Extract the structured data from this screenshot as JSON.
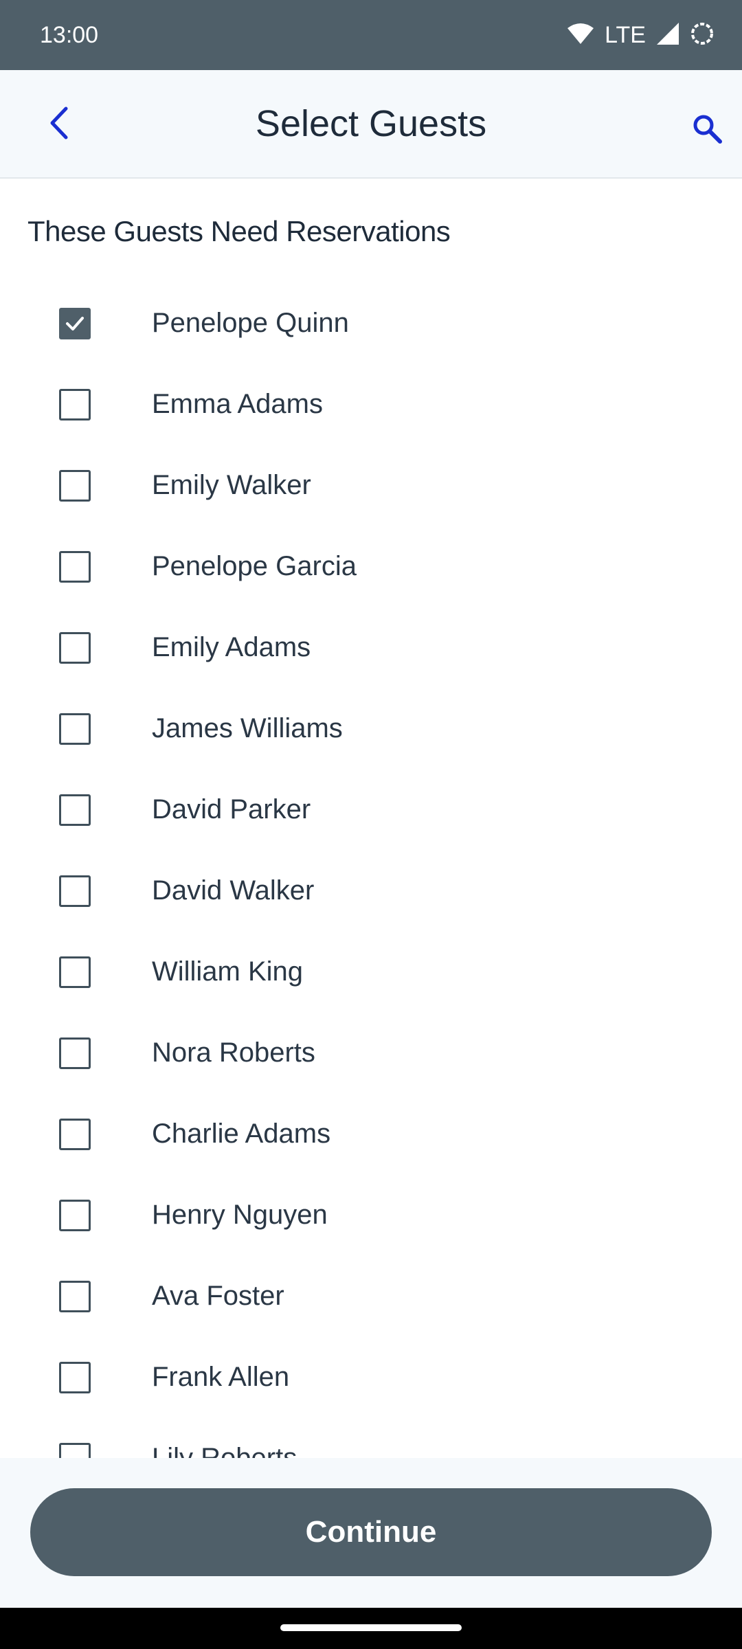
{
  "status_bar": {
    "time": "13:00",
    "network": "LTE",
    "icons": [
      "wifi-icon",
      "signal-icon",
      "battery-icon"
    ]
  },
  "app_bar": {
    "title": "Select Guests",
    "back_icon": "chevron-left-icon",
    "search_icon": "search-icon",
    "accent_color": "#1a2fd1"
  },
  "section": {
    "heading": "These Guests Need Reservations"
  },
  "guests": [
    {
      "name": "Penelope Quinn",
      "checked": true
    },
    {
      "name": "Emma Adams",
      "checked": false
    },
    {
      "name": "Emily Walker",
      "checked": false
    },
    {
      "name": "Penelope Garcia",
      "checked": false
    },
    {
      "name": "Emily Adams",
      "checked": false
    },
    {
      "name": "James Williams",
      "checked": false
    },
    {
      "name": "David Parker",
      "checked": false
    },
    {
      "name": "David Walker",
      "checked": false
    },
    {
      "name": "William King",
      "checked": false
    },
    {
      "name": "Nora Roberts",
      "checked": false
    },
    {
      "name": "Charlie Adams",
      "checked": false
    },
    {
      "name": "Henry Nguyen",
      "checked": false
    },
    {
      "name": "Ava Foster",
      "checked": false
    },
    {
      "name": "Frank Allen",
      "checked": false
    },
    {
      "name": "Lily Roberts",
      "checked": false
    }
  ],
  "footer": {
    "continue_label": "Continue"
  },
  "colors": {
    "primary_dark": "#4f5f69",
    "text": "#1e2b3a",
    "app_bar_bg": "#f5f9fc"
  }
}
